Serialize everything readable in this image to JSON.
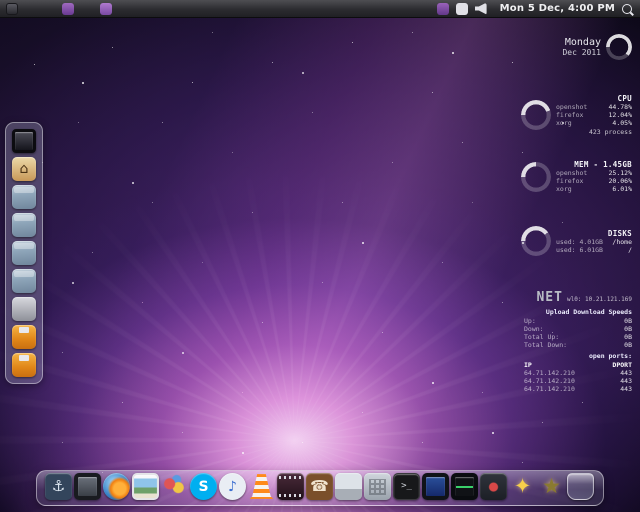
{
  "menubar": {
    "clock": "Mon 5 Dec, 4:00 PM",
    "left_icons": [
      {
        "name": "distro-menu",
        "kind": "mb-dark"
      },
      {
        "name": "workspace-indicator",
        "kind": "mb-purple"
      },
      {
        "name": "app-indicator",
        "kind": "mb-purple2"
      }
    ],
    "right_icons": [
      {
        "name": "media-indicator",
        "kind": "mb-purple-sm"
      },
      {
        "name": "microphone-indicator",
        "kind": "mb-mic"
      },
      {
        "name": "volume-indicator",
        "kind": "mb-vol"
      }
    ]
  },
  "left_dock": {
    "items": [
      {
        "name": "display",
        "kind": "display"
      },
      {
        "name": "home-folder",
        "kind": "home",
        "glyph": "⌂",
        "fg": "#4a3214"
      },
      {
        "name": "documents-folder",
        "kind": "folder"
      },
      {
        "name": "music-folder",
        "kind": "folder"
      },
      {
        "name": "pictures-folder",
        "kind": "folder"
      },
      {
        "name": "videos-folder",
        "kind": "folder"
      },
      {
        "name": "drive",
        "kind": "drive"
      },
      {
        "name": "usb-drive-1",
        "kind": "usb"
      },
      {
        "name": "usb-drive-2",
        "kind": "usb"
      }
    ]
  },
  "bottom_dock": {
    "items": [
      {
        "name": "anchor-app",
        "kind": "glyph",
        "glyph": "⚓",
        "color": "#33455c",
        "fg": "#dce6f0"
      },
      {
        "name": "dock-settings",
        "kind": "dark-screen"
      },
      {
        "name": "firefox",
        "kind": "firefox"
      },
      {
        "name": "photos",
        "kind": "photo"
      },
      {
        "name": "balloons",
        "kind": "balloons"
      },
      {
        "name": "skype",
        "kind": "circle-glyph",
        "glyph": "S",
        "color": "#00aff0",
        "fg": "#ffffff"
      },
      {
        "name": "itunes",
        "kind": "circle-glyph",
        "glyph": "♪",
        "color": "#e9edf4",
        "fg": "#3d6fd0"
      },
      {
        "name": "vlc",
        "kind": "vlc"
      },
      {
        "name": "movie-player",
        "kind": "film"
      },
      {
        "name": "contacts",
        "kind": "glyph",
        "glyph": "☎",
        "color": "#7a4f2a",
        "fg": "#f0e2cc"
      },
      {
        "name": "hard-drive",
        "kind": "drive2"
      },
      {
        "name": "calculator",
        "kind": "calc"
      },
      {
        "name": "terminal",
        "kind": "terminal",
        "glyph": ">_"
      },
      {
        "name": "displays",
        "kind": "screen-blue"
      },
      {
        "name": "system-monitor",
        "kind": "screen-green"
      },
      {
        "name": "package-manager",
        "kind": "dark-red-dot"
      },
      {
        "name": "sparkle-star",
        "kind": "star",
        "glyph": "✦",
        "fg": "#f6cf4a"
      },
      {
        "name": "dark-star",
        "kind": "star",
        "glyph": "★",
        "fg": "#8a7a30"
      },
      {
        "name": "trash",
        "kind": "glass"
      }
    ]
  },
  "widgets": {
    "calendar": {
      "weekday": "Monday",
      "date": "Dec 2011"
    },
    "cpu": {
      "title": "CPU",
      "rows": [
        {
          "name": "openshot",
          "value": "44.78%"
        },
        {
          "name": "firefox",
          "value": "12.04%"
        },
        {
          "name": "xorg",
          "value": "4.05%"
        }
      ],
      "footer": "423 process"
    },
    "mem": {
      "title": "MEM - 1.45GB",
      "rows": [
        {
          "name": "openshot",
          "value": "25.12%"
        },
        {
          "name": "firefox",
          "value": "20.06%"
        },
        {
          "name": "xorg",
          "value": "6.01%"
        }
      ]
    },
    "disks": {
      "title": "DISKS",
      "rows": [
        {
          "name": "used: 4.01GB",
          "value": "/home"
        },
        {
          "name": "used: 6.01GB",
          "value": "/"
        }
      ]
    },
    "net": {
      "title": "NET",
      "interface": "wl0: 10.21.121.169",
      "speeds_title": "Upload Download Speeds",
      "speed_rows": [
        {
          "name": "Up:",
          "value": "0B"
        },
        {
          "name": "Down:",
          "value": "0B"
        },
        {
          "name": "Total Up:",
          "value": "0B"
        },
        {
          "name": "Total Down:",
          "value": "0B"
        }
      ],
      "ports_title": "open ports:",
      "col_ip": "IP",
      "col_port": "DPORT",
      "port_rows": [
        {
          "name": "64.71.142.210",
          "value": "443"
        },
        {
          "name": "64.71.142.210",
          "value": "443"
        },
        {
          "name": "64.71.142.210",
          "value": "443"
        }
      ]
    }
  }
}
